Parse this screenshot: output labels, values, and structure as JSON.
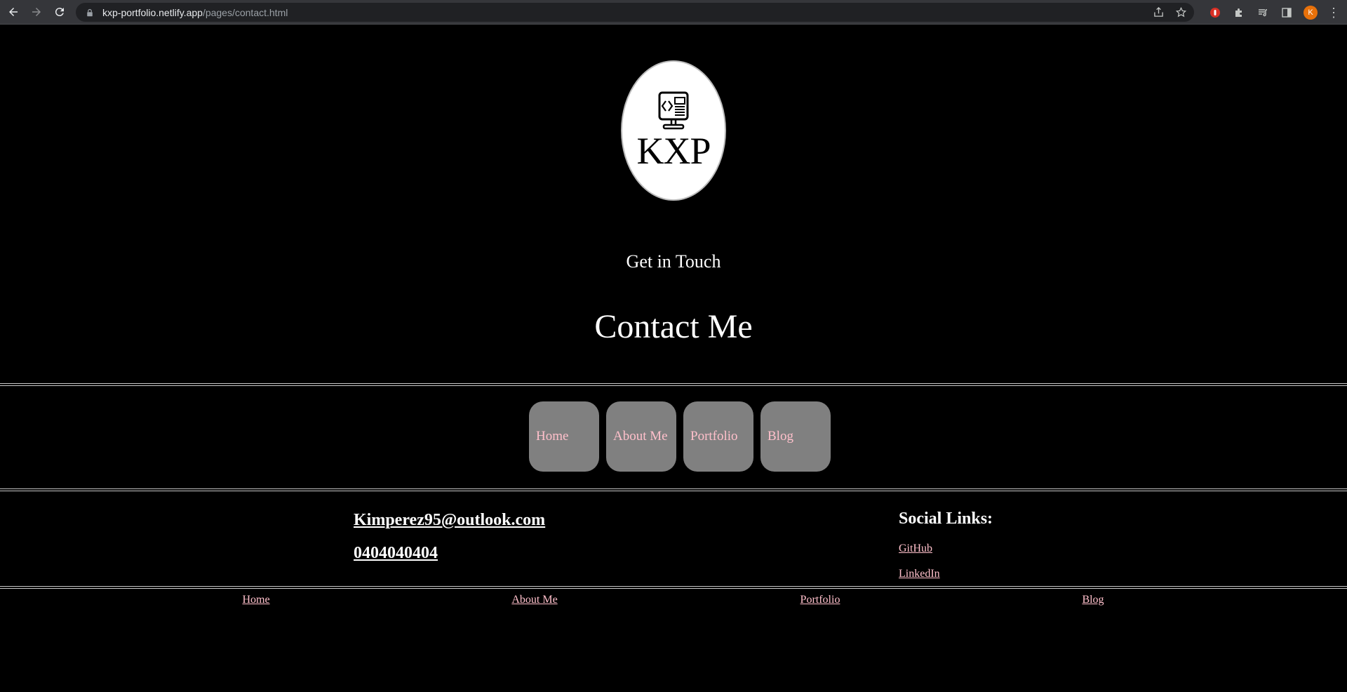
{
  "browser": {
    "url_host": "kxp-portfolio.netlify.app",
    "url_path": "/pages/contact.html",
    "profile_initial": "K",
    "icons": [
      "back-icon",
      "forward-icon",
      "reload-icon",
      "lock-icon",
      "share-icon",
      "star-icon",
      "extension-red-icon",
      "puzzle-icon",
      "media-icon",
      "sidebar-icon",
      "menu-icon"
    ]
  },
  "header": {
    "logo_text": "KXP",
    "tagline": "Get in Touch",
    "title": "Contact Me"
  },
  "nav": {
    "items": [
      {
        "label": "Home"
      },
      {
        "label": "About Me"
      },
      {
        "label": "Portfolio"
      },
      {
        "label": "Blog"
      }
    ]
  },
  "contact": {
    "email": "Kimperez95@outlook.com",
    "phone": "0404040404"
  },
  "social": {
    "title": "Social Links:",
    "links": [
      {
        "label": "GitHub"
      },
      {
        "label": "LinkedIn"
      }
    ]
  },
  "footer": {
    "links": [
      {
        "label": "Home"
      },
      {
        "label": "About Me"
      },
      {
        "label": "Portfolio"
      },
      {
        "label": "Blog"
      }
    ]
  },
  "colors": {
    "background": "#000000",
    "link": "#ffc0cb",
    "nav_button": "#808080",
    "avatar": "#e8710a"
  }
}
